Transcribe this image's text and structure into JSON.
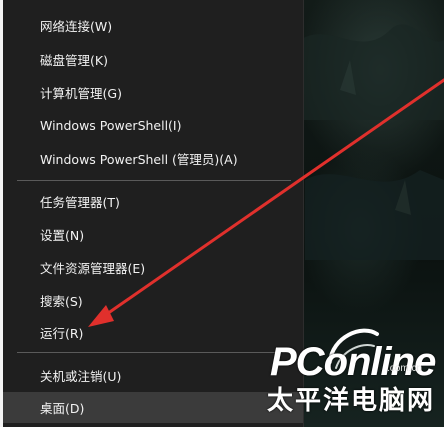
{
  "menu": {
    "items": [
      {
        "label": "网络连接(W)"
      },
      {
        "label": "磁盘管理(K)"
      },
      {
        "label": "计算机管理(G)"
      },
      {
        "label": "Windows PowerShell(I)"
      },
      {
        "label": "Windows PowerShell (管理员)(A)"
      },
      {
        "label": "任务管理器(T)"
      },
      {
        "label": "设置(N)"
      },
      {
        "label": "文件资源管理器(E)"
      },
      {
        "label": "搜索(S)"
      },
      {
        "label": "运行(R)"
      },
      {
        "label": "关机或注销(U)"
      },
      {
        "label": "桌面(D)"
      }
    ],
    "selected_item": "桌面(D)"
  },
  "annotation": {
    "type": "arrow",
    "color": "#e0302c",
    "points_to": "运行(R)"
  },
  "watermark": {
    "brand": "PConline",
    "domain": ".com.cn",
    "subtitle": "太平洋电脑网"
  },
  "colors": {
    "menu_bg": "#1f1f1f",
    "selected_bg": "#3b3b3b",
    "text": "#f2f2f2",
    "arrow": "#e0302c"
  }
}
